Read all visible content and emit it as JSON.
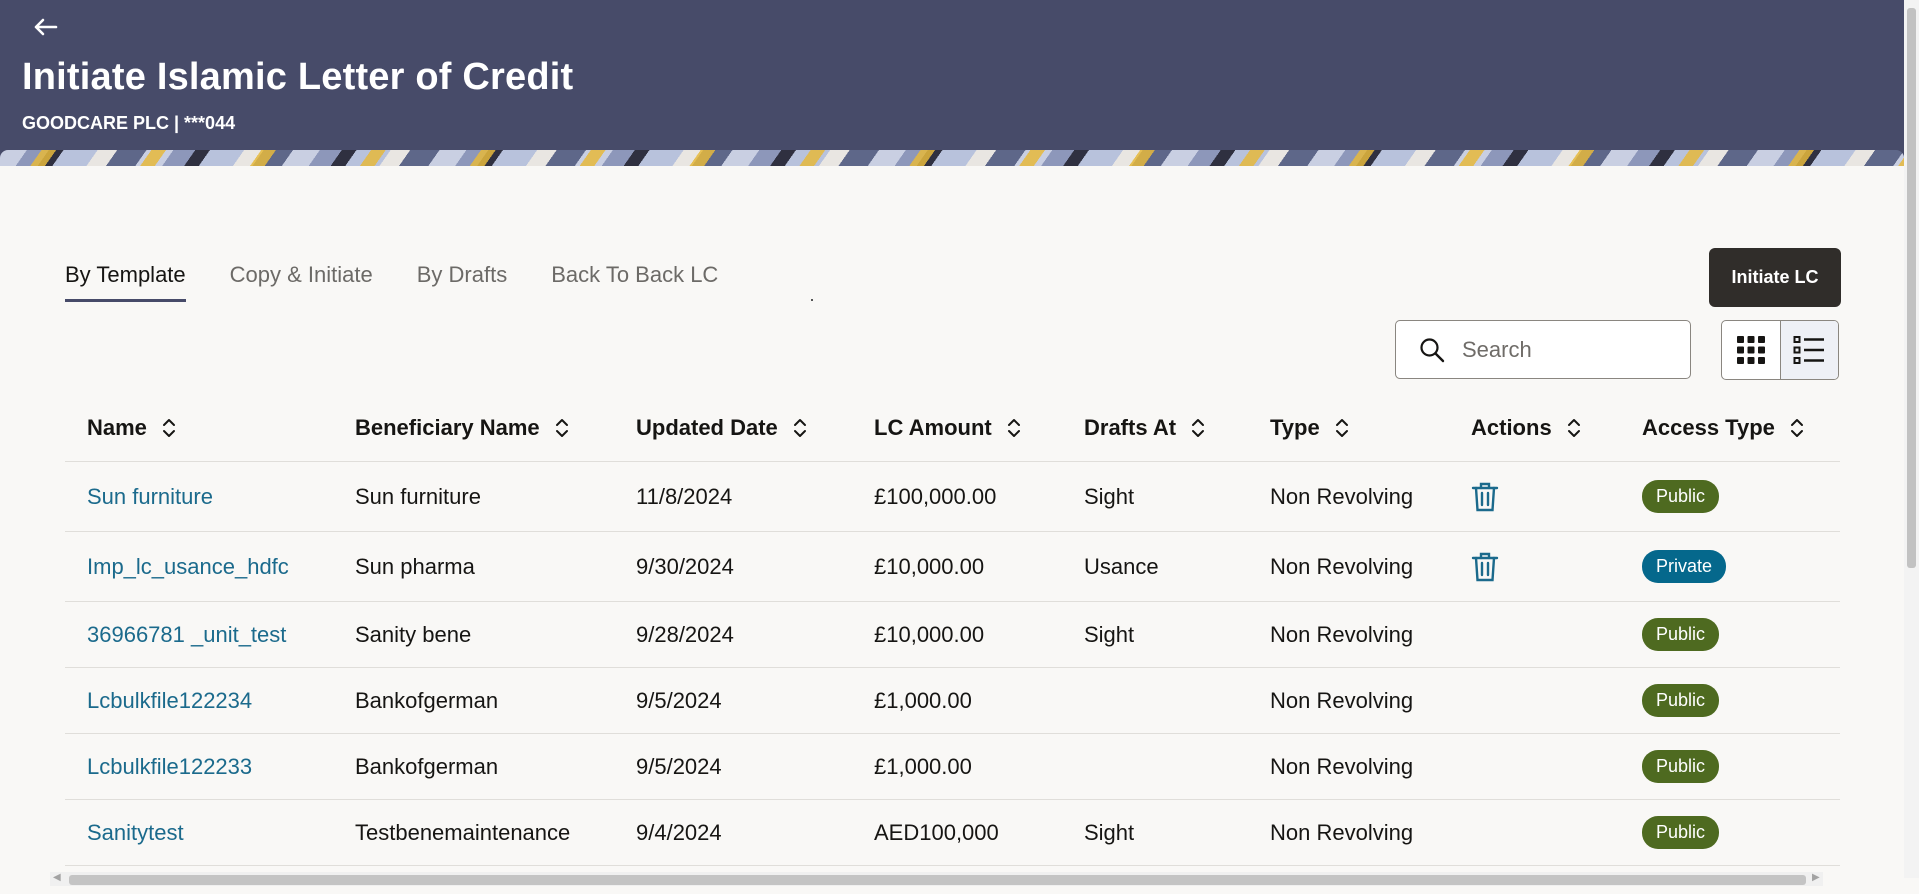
{
  "header": {
    "title": "Initiate Islamic Letter of Credit",
    "subtitle": "GOODCARE PLC | ***044"
  },
  "tabs": [
    {
      "label": "By Template",
      "active": true
    },
    {
      "label": "Copy & Initiate",
      "active": false
    },
    {
      "label": "By Drafts",
      "active": false
    },
    {
      "label": "Back To Back LC",
      "active": false
    }
  ],
  "initiate_button": "Initiate LC",
  "search": {
    "placeholder": "Search",
    "value": ""
  },
  "table": {
    "columns": [
      "Name",
      "Beneficiary Name",
      "Updated Date",
      "LC Amount",
      "Drafts At",
      "Type",
      "Actions",
      "Access Type"
    ],
    "rows": [
      {
        "name": "Sun furniture",
        "beneficiary": "Sun furniture",
        "date": "11/8/2024",
        "amount": "£100,000.00",
        "drafts_at": "Sight",
        "type": "Non Revolving",
        "delete": true,
        "access": "Public"
      },
      {
        "name": "Imp_lc_usance_hdfc",
        "beneficiary": "Sun pharma",
        "date": "9/30/2024",
        "amount": "£10,000.00",
        "drafts_at": "Usance",
        "type": "Non Revolving",
        "delete": true,
        "access": "Private"
      },
      {
        "name": "36966781 _unit_test",
        "beneficiary": "Sanity bene",
        "date": "9/28/2024",
        "amount": "£10,000.00",
        "drafts_at": "Sight",
        "type": "Non Revolving",
        "delete": false,
        "access": "Public"
      },
      {
        "name": "Lcbulkfile122234",
        "beneficiary": "Bankofgerman",
        "date": "9/5/2024",
        "amount": "£1,000.00",
        "drafts_at": "",
        "type": "Non Revolving",
        "delete": false,
        "access": "Public"
      },
      {
        "name": "Lcbulkfile122233",
        "beneficiary": "Bankofgerman",
        "date": "9/5/2024",
        "amount": "£1,000.00",
        "drafts_at": "",
        "type": "Non Revolving",
        "delete": false,
        "access": "Public"
      },
      {
        "name": "Sanitytest",
        "beneficiary": "Testbenemaintenance",
        "date": "9/4/2024",
        "amount": "AED100,000",
        "drafts_at": "Sight",
        "type": "Non Revolving",
        "delete": false,
        "access": "Public"
      }
    ]
  },
  "colors": {
    "header_bg": "#474b69",
    "link": "#1b6a8c",
    "public_badge": "#4e6a20",
    "private_badge": "#05688c",
    "primary_button": "#302d2a"
  }
}
